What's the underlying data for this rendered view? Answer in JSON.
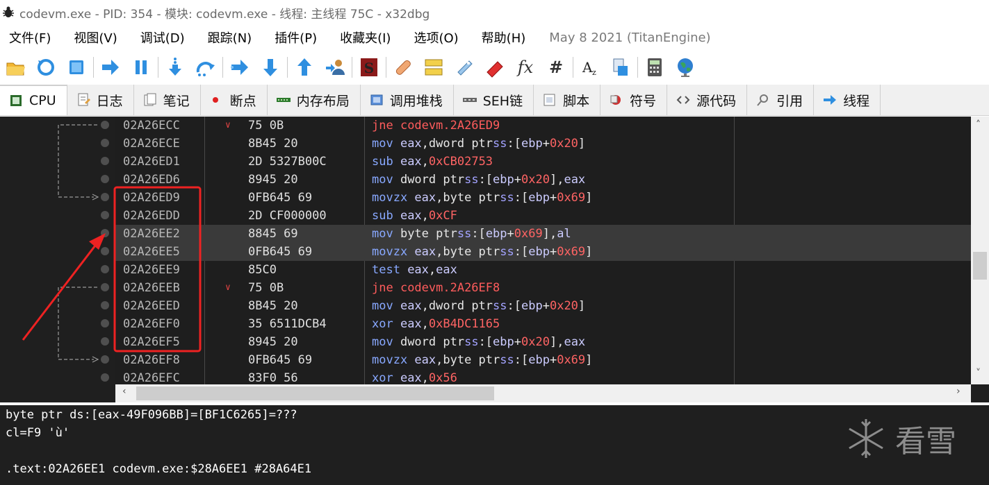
{
  "window": {
    "title": "codevm.exe - PID: 354 - 模块: codevm.exe - 线程: 主线程 75C - x32dbg"
  },
  "menu": {
    "items": [
      "文件(F)",
      "视图(V)",
      "调试(D)",
      "跟踪(N)",
      "插件(P)",
      "收藏夹(I)",
      "选项(O)",
      "帮助(H)"
    ],
    "info": "May 8 2021 (TitanEngine)"
  },
  "toolbar": {
    "buttons": [
      "open-icon",
      "restart-icon",
      "stop-icon",
      "run-icon",
      "pause-icon",
      "step-into-icon",
      "step-over-icon",
      "trace-into-icon",
      "trace-over-icon",
      "execute-till-return-icon",
      "run-to-user-code-icon",
      "scylla-icon",
      "patch-icon",
      "comment-icon",
      "label-icon",
      "bookmark-icon",
      "function-icon",
      "hash-icon",
      "font-icon",
      "calculator-icon",
      "help-icon",
      "globe-icon"
    ],
    "fx": "fx",
    "hash": "#"
  },
  "tabs": [
    {
      "label": "CPU",
      "icon": "cpu-icon"
    },
    {
      "label": "日志",
      "icon": "log-icon"
    },
    {
      "label": "笔记",
      "icon": "notes-icon"
    },
    {
      "label": "断点",
      "icon": "breakpoint-icon"
    },
    {
      "label": "内存布局",
      "icon": "memory-map-icon"
    },
    {
      "label": "调用堆栈",
      "icon": "call-stack-icon"
    },
    {
      "label": "SEH链",
      "icon": "seh-chain-icon"
    },
    {
      "label": "脚本",
      "icon": "script-icon"
    },
    {
      "label": "符号",
      "icon": "symbols-icon"
    },
    {
      "label": "源代码",
      "icon": "source-icon"
    },
    {
      "label": "引用",
      "icon": "references-icon"
    },
    {
      "label": "线程",
      "icon": "threads-icon"
    }
  ],
  "disasm": {
    "rows": [
      {
        "addr": "02A26ECC",
        "arrow": "v",
        "bytes": "75 0B",
        "mn": "jne",
        "ops": [
          [
            "jmp",
            "codevm.2A26ED9"
          ]
        ]
      },
      {
        "addr": "02A26ECE",
        "arrow": "",
        "bytes": "8B45 20",
        "mn": "mov",
        "ops": [
          [
            "reg",
            "eax"
          ],
          [
            "txt",
            ",dword ptr"
          ],
          [
            "seg",
            "ss"
          ],
          [
            "txt",
            ":["
          ],
          [
            "reg",
            "ebp"
          ],
          [
            "txt",
            "+"
          ],
          [
            "num",
            "0x20"
          ],
          [
            "txt",
            "]"
          ]
        ]
      },
      {
        "addr": "02A26ED1",
        "arrow": "",
        "bytes": "2D 5327B00C",
        "mn": "sub",
        "ops": [
          [
            "reg",
            "eax"
          ],
          [
            "txt",
            ","
          ],
          [
            "num",
            "0xCB02753"
          ]
        ]
      },
      {
        "addr": "02A26ED6",
        "arrow": "",
        "bytes": "8945 20",
        "mn": "mov",
        "ops": [
          [
            "txt",
            "dword ptr"
          ],
          [
            "seg",
            "ss"
          ],
          [
            "txt",
            ":["
          ],
          [
            "reg",
            "ebp"
          ],
          [
            "txt",
            "+"
          ],
          [
            "num",
            "0x20"
          ],
          [
            "txt",
            "],"
          ],
          [
            "reg",
            "eax"
          ]
        ]
      },
      {
        "addr": "02A26ED9",
        "arrow": "",
        "bytes": "0FB645 69",
        "mn": "movzx",
        "ops": [
          [
            "reg",
            "eax"
          ],
          [
            "txt",
            ",byte ptr"
          ],
          [
            "seg",
            "ss"
          ],
          [
            "txt",
            ":["
          ],
          [
            "reg",
            "ebp"
          ],
          [
            "txt",
            "+"
          ],
          [
            "num",
            "0x69"
          ],
          [
            "txt",
            "]"
          ]
        ]
      },
      {
        "addr": "02A26EDD",
        "arrow": "",
        "bytes": "2D CF000000",
        "mn": "sub",
        "ops": [
          [
            "reg",
            "eax"
          ],
          [
            "txt",
            ","
          ],
          [
            "num",
            "0xCF"
          ]
        ]
      },
      {
        "addr": "02A26EE2",
        "arrow": "",
        "bytes": "8845 69",
        "mn": "mov",
        "ops": [
          [
            "txt",
            "byte ptr"
          ],
          [
            "seg",
            "ss"
          ],
          [
            "txt",
            ":["
          ],
          [
            "reg",
            "ebp"
          ],
          [
            "txt",
            "+"
          ],
          [
            "num",
            "0x69"
          ],
          [
            "txt",
            "],"
          ],
          [
            "reg",
            "al"
          ]
        ],
        "hl": true
      },
      {
        "addr": "02A26EE5",
        "arrow": "",
        "bytes": "0FB645 69",
        "mn": "movzx",
        "ops": [
          [
            "reg",
            "eax"
          ],
          [
            "txt",
            ",byte ptr"
          ],
          [
            "seg",
            "ss"
          ],
          [
            "txt",
            ":["
          ],
          [
            "reg",
            "ebp"
          ],
          [
            "txt",
            "+"
          ],
          [
            "num",
            "0x69"
          ],
          [
            "txt",
            "]"
          ]
        ],
        "hl": true
      },
      {
        "addr": "02A26EE9",
        "arrow": "",
        "bytes": "85C0",
        "mn": "test",
        "ops": [
          [
            "reg",
            "eax"
          ],
          [
            "txt",
            ","
          ],
          [
            "reg",
            "eax"
          ]
        ]
      },
      {
        "addr": "02A26EEB",
        "arrow": "v",
        "bytes": "75 0B",
        "mn": "jne",
        "ops": [
          [
            "jmp",
            "codevm.2A26EF8"
          ]
        ]
      },
      {
        "addr": "02A26EED",
        "arrow": "",
        "bytes": "8B45 20",
        "mn": "mov",
        "ops": [
          [
            "reg",
            "eax"
          ],
          [
            "txt",
            ",dword ptr"
          ],
          [
            "seg",
            "ss"
          ],
          [
            "txt",
            ":["
          ],
          [
            "reg",
            "ebp"
          ],
          [
            "txt",
            "+"
          ],
          [
            "num",
            "0x20"
          ],
          [
            "txt",
            "]"
          ]
        ]
      },
      {
        "addr": "02A26EF0",
        "arrow": "",
        "bytes": "35 6511DCB4",
        "mn": "xor",
        "ops": [
          [
            "reg",
            "eax"
          ],
          [
            "txt",
            ","
          ],
          [
            "num",
            "0xB4DC1165"
          ]
        ]
      },
      {
        "addr": "02A26EF5",
        "arrow": "",
        "bytes": "8945 20",
        "mn": "mov",
        "ops": [
          [
            "txt",
            "dword ptr"
          ],
          [
            "seg",
            "ss"
          ],
          [
            "txt",
            ":["
          ],
          [
            "reg",
            "ebp"
          ],
          [
            "txt",
            "+"
          ],
          [
            "num",
            "0x20"
          ],
          [
            "txt",
            "],"
          ],
          [
            "reg",
            "eax"
          ]
        ]
      },
      {
        "addr": "02A26EF8",
        "arrow": "",
        "bytes": "0FB645 69",
        "mn": "movzx",
        "ops": [
          [
            "reg",
            "eax"
          ],
          [
            "txt",
            ",byte ptr"
          ],
          [
            "seg",
            "ss"
          ],
          [
            "txt",
            ":["
          ],
          [
            "reg",
            "ebp"
          ],
          [
            "txt",
            "+"
          ],
          [
            "num",
            "0x69"
          ],
          [
            "txt",
            "]"
          ]
        ]
      },
      {
        "addr": "02A26EFC",
        "arrow": "",
        "bytes": "83F0 56",
        "mn": "xor",
        "ops": [
          [
            "reg",
            "eax"
          ],
          [
            "txt",
            ","
          ],
          [
            "num",
            "0x56"
          ]
        ]
      }
    ]
  },
  "info": {
    "lines": [
      "byte ptr ds:[eax-49F096BB]=[BF1C6265]=???",
      "cl=F9 'ù'",
      "",
      ".text:02A26EE1 codevm.exe:$28A6EE1 #28A64E1"
    ],
    "watermark": "看雪"
  }
}
